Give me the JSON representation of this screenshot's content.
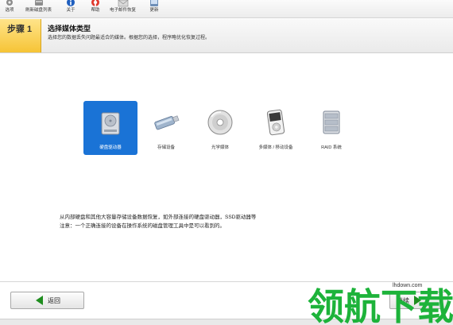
{
  "toolbar": {
    "items": [
      {
        "label": "选项",
        "icon": "gear-icon"
      },
      {
        "label": "刷新磁盘列表",
        "icon": "refresh-disk-icon"
      },
      {
        "label": "关于",
        "icon": "info-icon"
      },
      {
        "label": "帮助",
        "icon": "help-lifebuoy-icon"
      },
      {
        "label": "电子邮件恢复",
        "icon": "email-icon"
      },
      {
        "label": "更新",
        "icon": "update-icon"
      }
    ]
  },
  "step": {
    "number": "步骤 1",
    "title": "选择媒体类型",
    "description": "选择您的数据丢失问题最适合的媒体。根据您的选择，程序略优化恢复过程。"
  },
  "media": [
    {
      "label": "硬盘驱动器",
      "icon": "hard-drive-icon",
      "selected": true
    },
    {
      "label": "存储设备",
      "icon": "usb-drive-icon",
      "selected": false
    },
    {
      "label": "光学媒体",
      "icon": "optical-disc-icon",
      "selected": false
    },
    {
      "label": "多媒体 / 移动设备",
      "icon": "media-player-icon",
      "selected": false
    },
    {
      "label": "RAID 系统",
      "icon": "raid-icon",
      "selected": false
    }
  ],
  "description": {
    "line1": "从内部硬盘和其他大容量存储设备数据恢复，如外部连接的硬盘驱动器，SSD驱动器等",
    "line2": "注意：一个正确连接的设备在操作系统的磁盘管理工具中是可以看到的。"
  },
  "buttons": {
    "back": "返回",
    "next": "继续"
  },
  "watermark": {
    "url": "lhdown.com",
    "text": "领航下载"
  },
  "colors": {
    "selected_bg": "#1a73d6",
    "step_box": "#f6c436",
    "arrow": "#1e8d1e"
  }
}
